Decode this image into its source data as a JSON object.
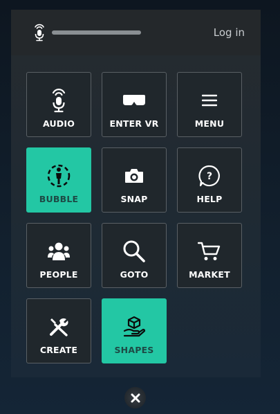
{
  "header": {
    "login_label": "Log in",
    "mic_level": 1.0
  },
  "tiles": [
    {
      "label": "AUDIO",
      "icon": "microphone-icon",
      "active": false
    },
    {
      "label": "ENTER VR",
      "icon": "vr-headset-icon",
      "active": false
    },
    {
      "label": "MENU",
      "icon": "hamburger-menu-icon",
      "active": false
    },
    {
      "label": "BUBBLE",
      "icon": "bubble-person-icon",
      "active": true
    },
    {
      "label": "SNAP",
      "icon": "camera-icon",
      "active": false
    },
    {
      "label": "HELP",
      "icon": "help-question-icon",
      "active": false
    },
    {
      "label": "PEOPLE",
      "icon": "people-icon",
      "active": false
    },
    {
      "label": "GOTO",
      "icon": "magnifier-icon",
      "active": false
    },
    {
      "label": "MARKET",
      "icon": "cart-icon",
      "active": false
    },
    {
      "label": "CREATE",
      "icon": "tools-icon",
      "active": false
    },
    {
      "label": "SHAPES",
      "icon": "hand-cube-icon",
      "active": true
    }
  ],
  "colors": {
    "accent": "#23c7a4",
    "tile_border": "#5a6065",
    "active_label": "#1d4a45"
  },
  "close_icon": "close-icon"
}
